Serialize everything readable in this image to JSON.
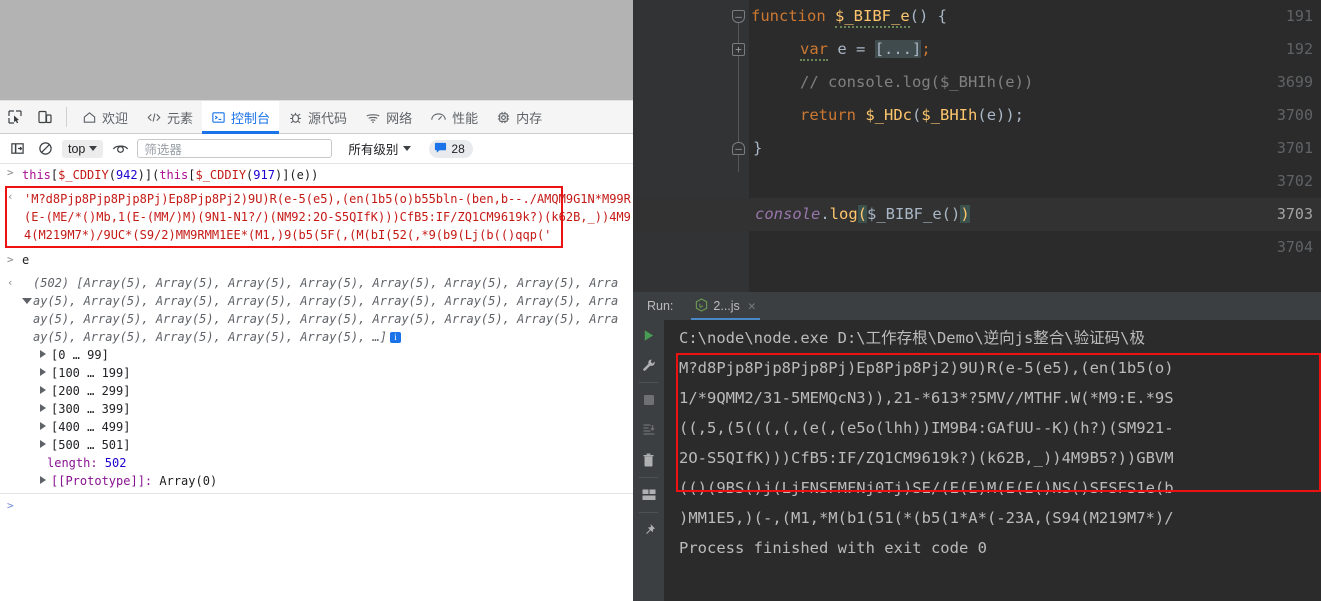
{
  "devtools": {
    "toolbar_icons": [
      "inspect-element-icon",
      "device-toolbar-icon"
    ],
    "tabs": [
      {
        "label": "欢迎",
        "icon": "home-icon",
        "active": false
      },
      {
        "label": "元素",
        "icon": "code-brackets-icon",
        "active": false
      },
      {
        "label": "控制台",
        "icon": "console-terminal-icon",
        "active": true
      },
      {
        "label": "源代码",
        "icon": "bug-icon",
        "active": false
      },
      {
        "label": "网络",
        "icon": "wifi-icon",
        "active": false
      },
      {
        "label": "性能",
        "icon": "gauge-icon",
        "active": false
      },
      {
        "label": "内存",
        "icon": "chip-icon",
        "active": false
      }
    ],
    "filterbar": {
      "sidebar_toggle_icon": "show-console-sidebar-icon",
      "clear_icon": "clear-console-icon",
      "context_value": "top",
      "eye_icon": "live-expression-icon",
      "filter_placeholder": "筛选器",
      "level_value": "所有级别",
      "badge_icon": "message-bubble-icon",
      "badge_count": "28"
    },
    "console": {
      "input_line": {
        "prefix": "this[",
        "kw1": "this",
        "id1": "$_CDDIY",
        "num1": "942",
        "id2": "$_CDDIY",
        "num2": "917",
        "full": "this[$_CDDIY(942)](this[$_CDDIY(917)](e))"
      },
      "string_result": [
        "'M?d8Pjp8Pjp8Pjp8Pj)Ep8Pjp8Pj2)9U)R(e-5(e5),(en(1b5(o)b55bln-(ben,b--./AMQM9G1N*M99R",
        "(E-(ME/*()Mb,1(E-(MM/)M)(9N1-N1?/)(NM92:2O-S5QIfK)))CfB5:IF/ZQ1CM9619k?)(k62B,_))4M9",
        "4(M219M7*)/9UC*(S9/2)MM9RMM1EE*(M1,)9(b5(5F(,(M(bI(52(,*9(b9(Lj(b(()qqp('"
      ],
      "second_input": "e",
      "array_preview": [
        "(502) [Array(5), Array(5), Array(5), Array(5), Array(5), Array(5), Array(5), Arra",
        "ay(5), Array(5), Array(5), Array(5), Array(5), Array(5), Array(5), Array(5), Arra",
        "ay(5), Array(5), Array(5), Array(5), Array(5), Array(5), Array(5), Array(5), Arra",
        "ay(5), Array(5), Array(5), Array(5), Array(5), …]"
      ],
      "buckets": [
        "[0 … 99]",
        "[100 … 199]",
        "[200 … 299]",
        "[300 … 399]",
        "[400 … 499]",
        "[500 … 501]"
      ],
      "length_key": "length: ",
      "length_value": "502",
      "prototype_key": "[[Prototype]]: ",
      "prototype_value": "Array(0)"
    }
  },
  "ide": {
    "editor": {
      "lines": [
        {
          "num": "191",
          "text": "function $_BIBF_e() {"
        },
        {
          "num": "192",
          "text": "    var e = [...];"
        },
        {
          "num": "3699",
          "text": "    // console.log($_BHIh(e))"
        },
        {
          "num": "3700",
          "text": "    return $_HDc($_BHIh(e));"
        },
        {
          "num": "3701",
          "text": "}"
        },
        {
          "num": "3702",
          "text": ""
        },
        {
          "num": "3703",
          "text": "console.log($_BIBF_e())"
        },
        {
          "num": "3704",
          "text": ""
        }
      ],
      "tokens": {
        "kw_function": "function",
        "fn_name": "$_BIBF_e",
        "kw_var": "var",
        "var_name": "e",
        "folded_array": "[...]",
        "comment": "// console.log($_BHIh(e))",
        "kw_return": "return",
        "call_outer": "$_HDc",
        "call_inner": "$_BHIh",
        "console_obj": "console",
        "log_method": "log",
        "invoke": "$_BIBF_e()"
      },
      "current_line": "3703"
    },
    "run": {
      "label": "Run:",
      "tab_name": "2...js",
      "tab_icon": "nodejs-icon",
      "close_icon": "close-icon",
      "toolbar": [
        "rerun-play-icon",
        "edit-configuration-wrench-icon",
        "stop-square-icon",
        "scroll-to-end-icon",
        "trash-delete-icon",
        "layout-settings-icon",
        "pin-tab-icon"
      ],
      "output": [
        "C:\\node\\node.exe D:\\工作存根\\Demo\\逆向js整合\\验证码\\极",
        "M?d8Pjp8Pjp8Pjp8Pj)Ep8Pjp8Pj2)9U)R(e-5(e5),(en(1b5(o)",
        "1/*9QMM2/31-5MEMQcN3)),21-*613*?5MV//MTHF.W(*M9:E.*9S",
        "((,5,(5(((,(,(e(,(e5o(lhh))IM9B4:GAfUU--K)(h?)(SM921-",
        "2O-S5QIfK)))CfB5:IF/ZQ1CM9619k?)(k62B,_))4M9B5?))GBVM",
        "(()(9BS()j(LjFNSFMFNj0Tj)SE/(E(E)M(E(E()NS()SFSFS1e(b",
        ")MM1E5,)(-,(M1,*M(b1(51(*(b5(1*A*(-23A,(S94(M219M7*)/",
        "Process finished with exit code 0"
      ]
    }
  },
  "colors": {
    "devtools_accent": "#1a73e8",
    "annotation_red": "#ee1111",
    "ide_editor_bg": "#2b2b2b",
    "ide_panel_bg": "#3c3f41",
    "ide_keyword": "#cc7832",
    "ide_function": "#ffc66d",
    "ide_comment": "#808080",
    "run_tab_underline": "#4a88c7"
  }
}
